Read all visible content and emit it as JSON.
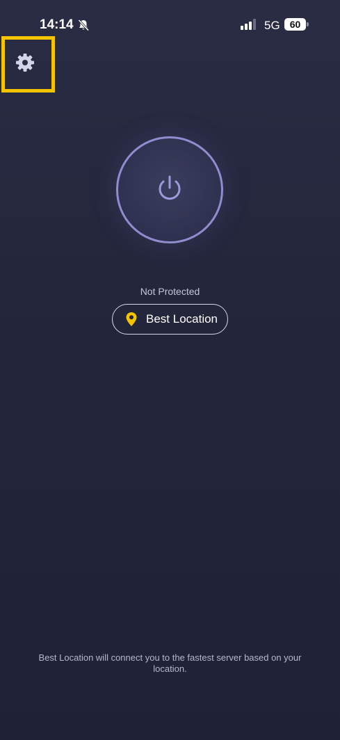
{
  "status_bar": {
    "time": "14:14",
    "network": "5G",
    "battery": "60",
    "icons": [
      "bell-slash-icon",
      "signal-bars-icon",
      "battery-icon"
    ]
  },
  "settings": {
    "icon": "gear-icon",
    "highlight_color": "#f5c400"
  },
  "power": {
    "icon": "power-icon",
    "ring_color": "#8f8dd0"
  },
  "connection": {
    "status": "Not Protected"
  },
  "location": {
    "label": "Best Location",
    "icon": "map-pin-icon",
    "pin_color": "#f5c400"
  },
  "footer": {
    "note": "Best Location will connect you to the fastest server based on your location."
  }
}
